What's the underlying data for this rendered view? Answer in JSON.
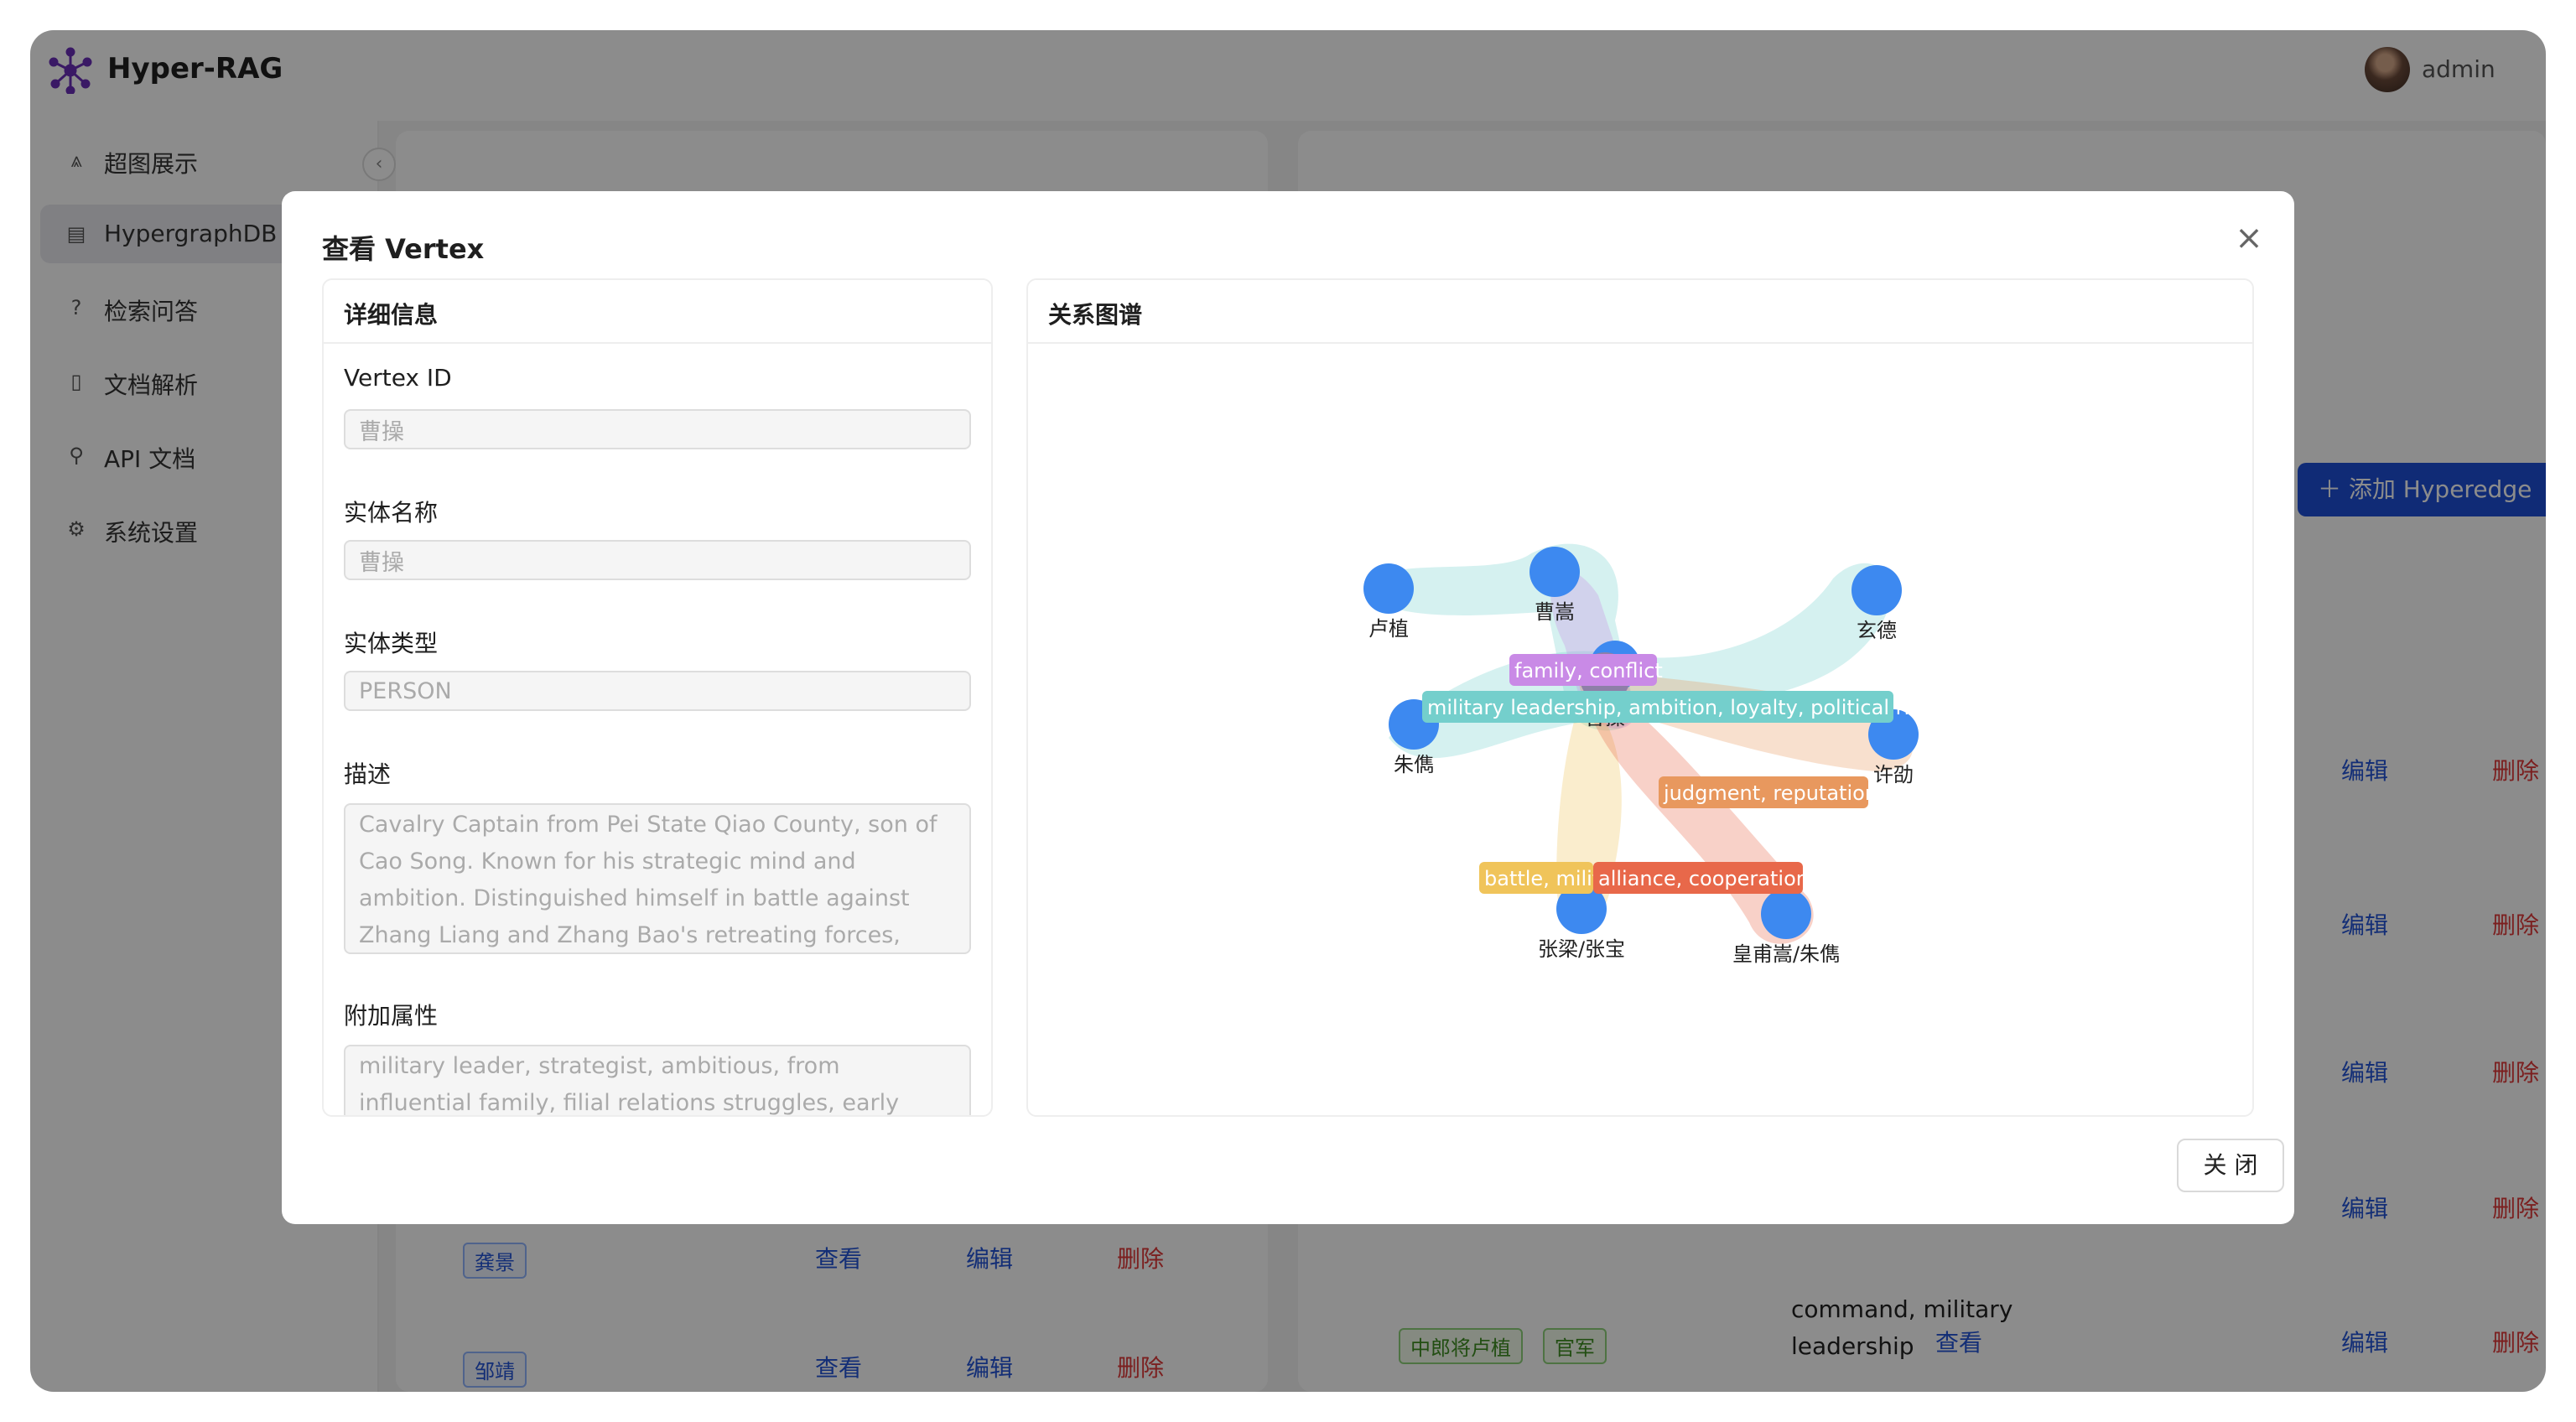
{
  "app": {
    "title": "Hyper-RAG",
    "user": "admin"
  },
  "sidebar": {
    "items": [
      {
        "label": "超图展示",
        "icon": "share-icon"
      },
      {
        "label": "HypergraphDB",
        "icon": "database-icon"
      },
      {
        "label": "检索问答",
        "icon": "question-icon"
      },
      {
        "label": "文档解析",
        "icon": "file-icon"
      },
      {
        "label": "API 文档",
        "icon": "api-icon"
      },
      {
        "label": "系统设置",
        "icon": "gear-icon"
      }
    ]
  },
  "background": {
    "add_button": "添加 Hyperedge",
    "left_rows": [
      {
        "tag": "龚景"
      },
      {
        "tag": "邹靖"
      }
    ],
    "view": "查看",
    "edit": "编辑",
    "delete": "删除",
    "right_last_row": {
      "tag1": "中郎将卢植",
      "tag2": "官军",
      "keywords_1": "command, military",
      "keywords_2": "leadership"
    }
  },
  "modal": {
    "title": "查看 Vertex",
    "detail_title": "详细信息",
    "graph_title": "关系图谱",
    "fields": {
      "vertex_id_label": "Vertex ID",
      "vertex_id": "曹操",
      "entity_name_label": "实体名称",
      "entity_name": "曹操",
      "entity_type_label": "实体类型",
      "entity_type": "PERSON",
      "description_label": "描述",
      "description": "Cavalry Captain from Pei State Qiao County, son of Cao Song. Known for his strategic mind and ambition. Distinguished himself in battle against Zhang Liang and Zhang Bao's retreating forces, killing over ten thousand",
      "attributes_label": "附加属性",
      "attributes": "military leader, strategist, ambitious, from influential family, filial relations struggles, early career official"
    },
    "close_button": "关 闭"
  },
  "graph": {
    "nodes": [
      "曹嵩",
      "卢植",
      "玄德",
      "皇甫嵩",
      "曹操",
      "朱儁",
      "许劭",
      "张梁/张宝",
      "皇甫嵩/朱儁"
    ],
    "edges": [
      {
        "label": "family, conflict",
        "color": "#c98ae6"
      },
      {
        "label": "military leadership, ambition, loyalty, political rise",
        "color": "#74cfcc"
      },
      {
        "label": "judgment, reputation",
        "color": "#e8985e"
      },
      {
        "label": "battle, milit",
        "color": "#f0c45a"
      },
      {
        "label": "alliance, cooperation",
        "color": "#e8684a"
      }
    ],
    "node_color": "#3d89f0"
  }
}
